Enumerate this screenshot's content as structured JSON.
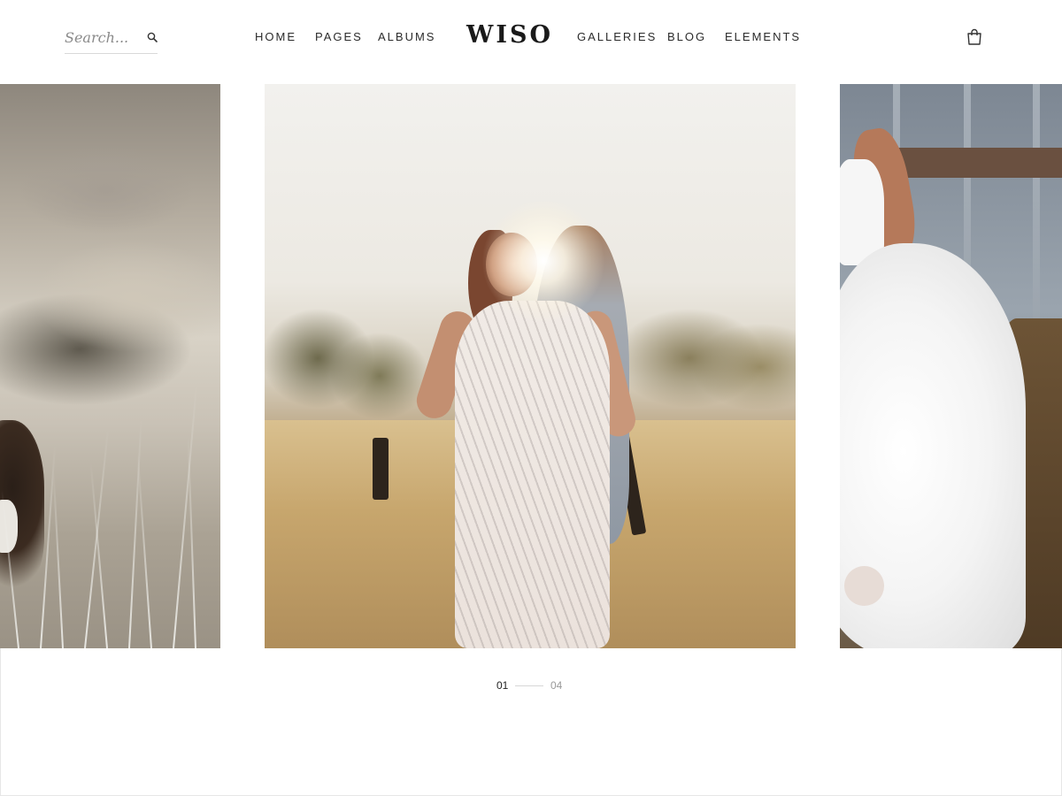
{
  "header": {
    "search": {
      "placeholder": "Search..."
    },
    "nav_left": [
      "HOME",
      "PAGES",
      "ALBUMS"
    ],
    "logo": "WISO",
    "nav_right": [
      "GALLERIES",
      "BLOG",
      "ELEMENTS"
    ],
    "icons": {
      "search": "search-icon",
      "cart": "shopping-bag-icon"
    }
  },
  "gallery": {
    "slides": [
      {
        "role": "previous",
        "visible": "partial"
      },
      {
        "role": "current",
        "visible": "full"
      },
      {
        "role": "next",
        "visible": "partial"
      }
    ],
    "pager": {
      "current": "01",
      "total": "04"
    }
  },
  "colors": {
    "text": "#222222",
    "muted": "#9a9a9a",
    "divider": "#d6d6d6",
    "background": "#ffffff"
  }
}
